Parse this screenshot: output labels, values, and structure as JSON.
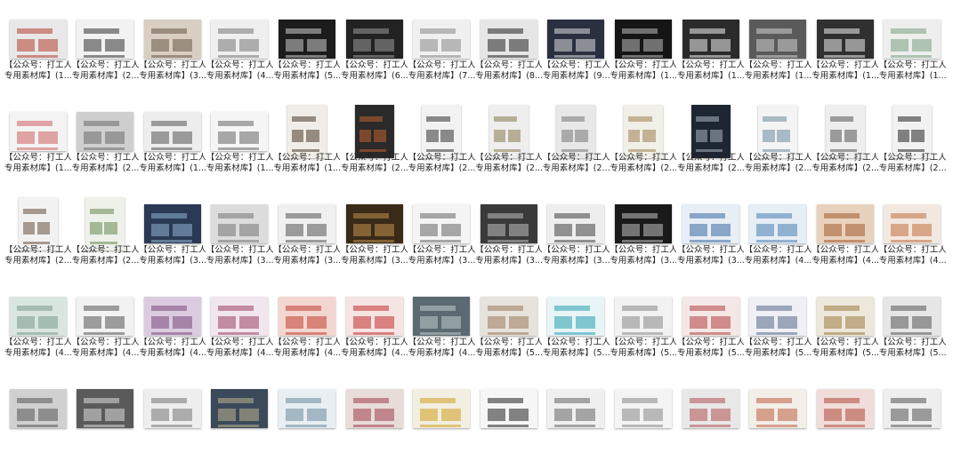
{
  "files": [
    {
      "line1": "【公众号：打工人",
      "line2": "专用素材库】(1...",
      "o": "land",
      "bg": "#e8e8e8",
      "fg": "#b04030"
    },
    {
      "line1": "【公众号：打工人",
      "line2": "专用素材库】(2...",
      "o": "land",
      "bg": "#f2f2f2",
      "fg": "#333333"
    },
    {
      "line1": "【公众号：打工人",
      "line2": "专用素材库】(3...",
      "o": "land",
      "bg": "#d8cfc2",
      "fg": "#6b5a48"
    },
    {
      "line1": "【公众号：打工人",
      "line2": "专用素材库】(4...",
      "o": "land",
      "bg": "#efefef",
      "fg": "#777777"
    },
    {
      "line1": "【公众号：打工人",
      "line2": "专用素材库】(5...",
      "o": "land",
      "bg": "#1c1c1c",
      "fg": "#cccccc"
    },
    {
      "line1": "【公众号：打工人",
      "line2": "专用素材库】(6...",
      "o": "land",
      "bg": "#222222",
      "fg": "#999999"
    },
    {
      "line1": "【公众号：打工人",
      "line2": "专用素材库】(7...",
      "o": "land",
      "bg": "#f0f0f0",
      "fg": "#888888"
    },
    {
      "line1": "【公众号：打工人",
      "line2": "专用素材库】(8...",
      "o": "land",
      "bg": "#e6e6e6",
      "fg": "#222222"
    },
    {
      "line1": "【公众号：打工人",
      "line2": "专用素材库】(9...",
      "o": "land",
      "bg": "#2a3040",
      "fg": "#dddddd"
    },
    {
      "line1": "【公众号：打工人",
      "line2": "专用素材库】(1...",
      "o": "land",
      "bg": "#151515",
      "fg": "#bbbbbb"
    },
    {
      "line1": "【公众号：打工人",
      "line2": "专用素材库】(1...",
      "o": "land",
      "bg": "#2b2b2b",
      "fg": "#eeeeee"
    },
    {
      "line1": "【公众号：打工人",
      "line2": "专用素材库】(1...",
      "o": "land",
      "bg": "#5a5a5a",
      "fg": "#cfcfcf"
    },
    {
      "line1": "【公众号：打工人",
      "line2": "专用素材库】(1...",
      "o": "land",
      "bg": "#303030",
      "fg": "#eeeeee"
    },
    {
      "line1": "【公众号：打工人",
      "line2": "专用素材库】(1...",
      "o": "land",
      "bg": "#eeeeee",
      "fg": "#7aa080"
    },
    {
      "line1": "【公众号：打工人",
      "line2": "专用素材库】(1...",
      "o": "land",
      "bg": "#f3f3f3",
      "fg": "#d06060"
    },
    {
      "line1": "【公众号：打工人",
      "line2": "专用素材库】(2...",
      "o": "land",
      "bg": "#cfcfcf",
      "fg": "#6b6b6b"
    },
    {
      "line1": "【公众号：打工人",
      "line2": "专用素材库】(1...",
      "o": "land",
      "bg": "#ededed",
      "fg": "#555555"
    },
    {
      "line1": "【公众号：打工人",
      "line2": "专用素材库】(1...",
      "o": "land",
      "bg": "#f5f5f5",
      "fg": "#666666"
    },
    {
      "line1": "【公众号：打工人",
      "line2": "专用素材库】(1...",
      "o": "port",
      "bg": "#f0ede8",
      "fg": "#4a3a2a"
    },
    {
      "line1": "【公众号：打工人",
      "line2": "专用素材库】(2...",
      "o": "port",
      "bg": "#2a2a2a",
      "fg": "#c06030"
    },
    {
      "line1": "【公众号：打工人",
      "line2": "专用素材库】(2...",
      "o": "port",
      "bg": "#f2f2f2",
      "fg": "#333333"
    },
    {
      "line1": "【公众号：打工人",
      "line2": "专用素材库】(2...",
      "o": "port",
      "bg": "#eeeeee",
      "fg": "#8a7a50"
    },
    {
      "line1": "【公众号：打工人",
      "line2": "专用素材库】(2...",
      "o": "port",
      "bg": "#e8e8e8",
      "fg": "#777777"
    },
    {
      "line1": "【公众号：打工人",
      "line2": "专用素材库】(2...",
      "o": "port",
      "bg": "#f0efe8",
      "fg": "#a08050"
    },
    {
      "line1": "【公众号：打工人",
      "line2": "专用素材库】(2...",
      "o": "port",
      "bg": "#1e2633",
      "fg": "#aab4c0"
    },
    {
      "line1": "【公众号：打工人",
      "line2": "专用素材库】(2...",
      "o": "port",
      "bg": "#f4f4f4",
      "fg": "#6a8a9a"
    },
    {
      "line1": "【公众号：打工人",
      "line2": "专用素材库】(2...",
      "o": "port",
      "bg": "#eeeeee",
      "fg": "#555555"
    },
    {
      "line1": "【公众号：打工人",
      "line2": "专用素材库】(2...",
      "o": "port",
      "bg": "#f2f2f2",
      "fg": "#222222"
    },
    {
      "line1": "【公众号：打工人",
      "line2": "专用素材库】(2...",
      "o": "port",
      "bg": "#f2f2f2",
      "fg": "#6a5040"
    },
    {
      "line1": "【公众号：打工人",
      "line2": "专用素材库】(2...",
      "o": "port",
      "bg": "#eef0ea",
      "fg": "#6a8a50"
    },
    {
      "line1": "【公众号：打工人",
      "line2": "专用素材库】(3...",
      "o": "land",
      "bg": "#2a3a55",
      "fg": "#8fb0d0"
    },
    {
      "line1": "【公众号：打工人",
      "line2": "专用素材库】(3...",
      "o": "land",
      "bg": "#dcdcdc",
      "fg": "#777777"
    },
    {
      "line1": "【公众号：打工人",
      "line2": "专用素材库】(3...",
      "o": "land",
      "bg": "#f0f0f0",
      "fg": "#555555"
    },
    {
      "line1": "【公众号：打工人",
      "line2": "专用素材库】(3...",
      "o": "land",
      "bg": "#3a2a18",
      "fg": "#c09050"
    },
    {
      "line1": "【公众号：打工人",
      "line2": "专用素材库】(3...",
      "o": "land",
      "bg": "#f4f4f4",
      "fg": "#666666"
    },
    {
      "line1": "【公众号：打工人",
      "line2": "专用素材库】(3...",
      "o": "land",
      "bg": "#3a3a3a",
      "fg": "#bbbbbb"
    },
    {
      "line1": "【公众号：打工人",
      "line2": "专用素材库】(3...",
      "o": "land",
      "bg": "#eeeeee",
      "fg": "#444444"
    },
    {
      "line1": "【公众号：打工人",
      "line2": "专用素材库】(3...",
      "o": "land",
      "bg": "#1a1a1a",
      "fg": "#c0c0c0"
    },
    {
      "line1": "【公众号：打工人",
      "line2": "专用素材库】(3...",
      "o": "land",
      "bg": "#e8eef6",
      "fg": "#3a6aa0"
    },
    {
      "line1": "【公众号：打工人",
      "line2": "专用素材库】(4...",
      "o": "land",
      "bg": "#e6eef6",
      "fg": "#4a80b0"
    },
    {
      "line1": "【公众号：打工人",
      "line2": "专用素材库】(4...",
      "o": "land",
      "bg": "#e9d2bd",
      "fg": "#a05a30"
    },
    {
      "line1": "【公众号：打工人",
      "line2": "专用素材库】(4...",
      "o": "land",
      "bg": "#f3e8df",
      "fg": "#c07040"
    },
    {
      "line1": "【公众号：打工人",
      "line2": "专用素材库】(4...",
      "o": "land",
      "bg": "#d9e6e0",
      "fg": "#7a9a8a"
    },
    {
      "line1": "【公众号：打工人",
      "line2": "专用素材库】(4...",
      "o": "land",
      "bg": "#f2f2f2",
      "fg": "#555555"
    },
    {
      "line1": "【公众号：打工人",
      "line2": "专用素材库】(4...",
      "o": "land",
      "bg": "#dccbe0",
      "fg": "#7a4a7a"
    },
    {
      "line1": "【公众号：打工人",
      "line2": "专用素材库】(4...",
      "o": "land",
      "bg": "#f2e6ee",
      "fg": "#9a4060"
    },
    {
      "line1": "【公众号：打工人",
      "line2": "专用素材库】(4...",
      "o": "land",
      "bg": "#f4d6d0",
      "fg": "#c04030"
    },
    {
      "line1": "【公众号：打工人",
      "line2": "专用素材库】(4...",
      "o": "land",
      "bg": "#f6e4e2",
      "fg": "#c03030"
    },
    {
      "line1": "【公众号：打工人",
      "line2": "专用素材库】(4...",
      "o": "land",
      "bg": "#5a6a70",
      "fg": "#c0c8cc"
    },
    {
      "line1": "【公众号：打工人",
      "line2": "专用素材库】(5...",
      "o": "land",
      "bg": "#e6e2dc",
      "fg": "#9a7a5a"
    },
    {
      "line1": "【公众号：打工人",
      "line2": "专用素材库】(5...",
      "o": "land",
      "bg": "#e8f4f6",
      "fg": "#2aa0b0"
    },
    {
      "line1": "【公众号：打工人",
      "line2": "专用素材库】(5...",
      "o": "land",
      "bg": "#f2f2f2",
      "fg": "#888888"
    },
    {
      "line1": "【公众号：打工人",
      "line2": "专用素材库】(5...",
      "o": "land",
      "bg": "#f4e8e6",
      "fg": "#b04040"
    },
    {
      "line1": "【公众号：打工人",
      "line2": "专用素材库】(5...",
      "o": "land",
      "bg": "#eef0f4",
      "fg": "#5a6a8a"
    },
    {
      "line1": "【公众号：打工人",
      "line2": "专用素材库】(5...",
      "o": "land",
      "bg": "#eee8dc",
      "fg": "#9a7a40"
    },
    {
      "line1": "【公众号：打工人",
      "line2": "专用素材库】(5...",
      "o": "land",
      "bg": "#e6e6e6",
      "fg": "#555555"
    },
    {
      "line1": "",
      "line2": "",
      "o": "land",
      "bg": "#d0d0d0",
      "fg": "#555555"
    },
    {
      "line1": "",
      "line2": "",
      "o": "land",
      "bg": "#5a5a5a",
      "fg": "#dddddd"
    },
    {
      "line1": "",
      "line2": "",
      "o": "land",
      "bg": "#eeeeee",
      "fg": "#777777"
    },
    {
      "line1": "",
      "line2": "",
      "o": "land",
      "bg": "#3a4a5a",
      "fg": "#c0b090"
    },
    {
      "line1": "",
      "line2": "",
      "o": "land",
      "bg": "#e8eef2",
      "fg": "#6a8aa0"
    },
    {
      "line1": "",
      "line2": "",
      "o": "land",
      "bg": "#e8dcd8",
      "fg": "#a04050"
    },
    {
      "line1": "",
      "line2": "",
      "o": "land",
      "bg": "#f2efe2",
      "fg": "#d0a020"
    },
    {
      "line1": "",
      "line2": "",
      "o": "land",
      "bg": "#f6f6f6",
      "fg": "#222222"
    },
    {
      "line1": "",
      "line2": "",
      "o": "land",
      "bg": "#f0f0f0",
      "fg": "#666666"
    },
    {
      "line1": "",
      "line2": "",
      "o": "land",
      "bg": "#f4f4f4",
      "fg": "#888888"
    },
    {
      "line1": "",
      "line2": "",
      "o": "land",
      "bg": "#e8e8e8",
      "fg": "#b05050"
    },
    {
      "line1": "",
      "line2": "",
      "o": "land",
      "bg": "#f2eee8",
      "fg": "#c06040"
    },
    {
      "line1": "",
      "line2": "",
      "o": "land",
      "bg": "#f0dcd8",
      "fg": "#b04a3a"
    },
    {
      "line1": "",
      "line2": "",
      "o": "land",
      "bg": "#eeeeee",
      "fg": "#555555"
    }
  ]
}
